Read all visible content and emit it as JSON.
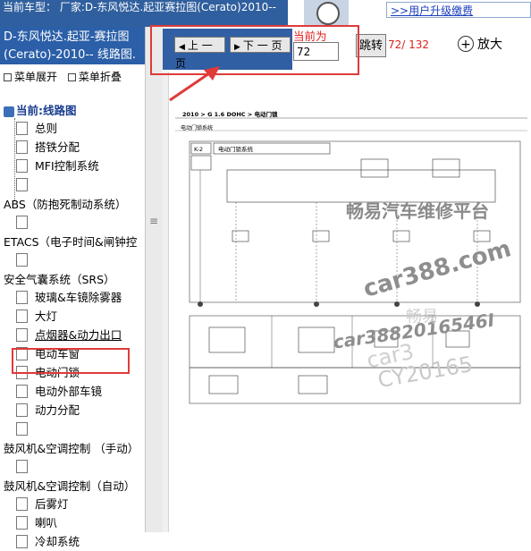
{
  "header": {
    "car_title": "当前车型： 厂家:D-东风悦达.起亚赛拉图(Cerato)2010--",
    "upgrade_link": ">>用户升级缴费"
  },
  "sidebar": {
    "category_header": "D-东风悦达.起亚-赛拉图(Cerato)-2010-- 线路图.",
    "expand_label": "菜单展开",
    "collapse_label": "菜单折叠",
    "current_label": "当前:线路图",
    "items": [
      {
        "label": "总则",
        "type": "doc"
      },
      {
        "label": "搭铁分配",
        "type": "doc"
      },
      {
        "label": "MFI控制系统",
        "type": "doc"
      },
      {
        "label": "",
        "type": "doc"
      },
      {
        "label": "ABS（防抱死制动系统）",
        "type": "folder"
      },
      {
        "label": "",
        "type": "doc"
      },
      {
        "label": "ETACS（电子时间&闸钟控",
        "type": "folder"
      },
      {
        "label": "",
        "type": "doc"
      },
      {
        "label": "安全气囊系统（SRS）",
        "type": "folder"
      },
      {
        "label": "玻璃&车镜除雾器",
        "type": "doc"
      },
      {
        "label": "大灯",
        "type": "doc"
      },
      {
        "label": "点烟器&动力出口",
        "type": "doc"
      },
      {
        "label": "电动车窗",
        "type": "doc"
      },
      {
        "label": "电动门锁",
        "type": "doc"
      },
      {
        "label": "电动外部车镜",
        "type": "doc"
      },
      {
        "label": "动力分配",
        "type": "doc"
      },
      {
        "label": "",
        "type": "doc"
      },
      {
        "label": "鼓风机&空调控制 （手动）",
        "type": "folder"
      },
      {
        "label": "",
        "type": "doc"
      },
      {
        "label": "鼓风机&空调控制（自动）",
        "type": "folder"
      },
      {
        "label": "后雾灯",
        "type": "doc"
      },
      {
        "label": "喇叭",
        "type": "doc"
      },
      {
        "label": "冷却系统",
        "type": "doc"
      }
    ]
  },
  "viewer": {
    "prev_label": "上 一 页",
    "next_label": "下 一 页",
    "current_page_label": "当前为",
    "page_input_value": "72",
    "jump_label": "跳转",
    "page_count": "72/ 132",
    "zoom_in_label": "放大"
  },
  "document": {
    "header_text": "2010 > G 1.6 DOHC > 电动门锁",
    "sub_text": "电动门锁系统",
    "diagram_title": "电动门锁系统",
    "module_code": "K-2"
  },
  "watermarks": [
    "畅易汽车维修平台",
    "car388.com",
    "car3882016546I",
    "CY20165",
    "car3",
    "畅易"
  ],
  "colors": {
    "header_blue": "#2f5f9e",
    "nav_blue": "#315fa3",
    "highlight_red": "#e03a3a",
    "page_count_red": "#e02020",
    "watermark_gray": "#b8b8b8"
  }
}
